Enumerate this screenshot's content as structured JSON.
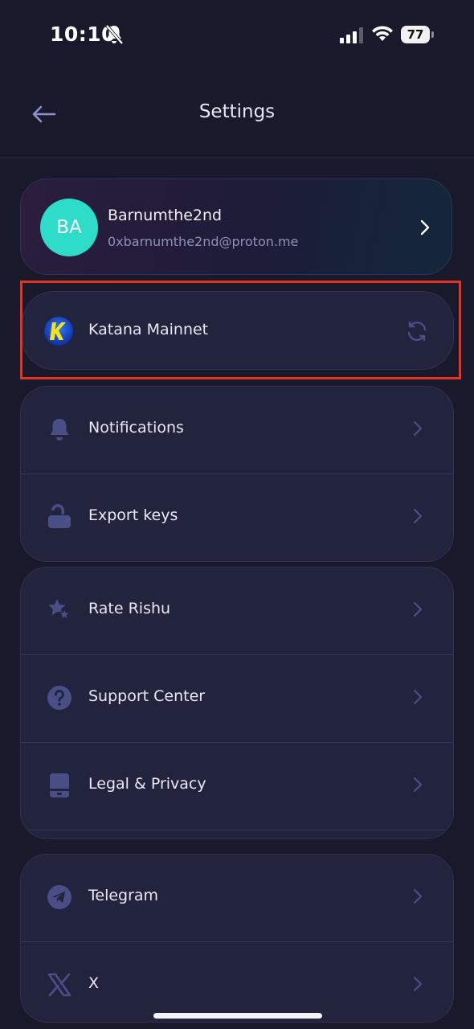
{
  "status_bar": {
    "time": "10:10",
    "battery": "77"
  },
  "header": {
    "title": "Settings"
  },
  "profile": {
    "initials": "BA",
    "name": "Barnumthe2nd",
    "email": "0xbarnumthe2nd@proton.me"
  },
  "network": {
    "label": "Katana Mainnet"
  },
  "groups": {
    "security": {
      "notifications": "Notifications",
      "export_keys": "Export keys"
    },
    "about": {
      "rate": "Rate Rishu",
      "support": "Support Center",
      "legal": "Legal & Privacy"
    },
    "social": {
      "telegram": "Telegram",
      "x": "X"
    }
  },
  "colors": {
    "background": "#181a2b",
    "card": "#22243d",
    "accent_icon": "#4a4e86",
    "avatar": "#2ddcc9",
    "highlight": "#e6321e"
  }
}
